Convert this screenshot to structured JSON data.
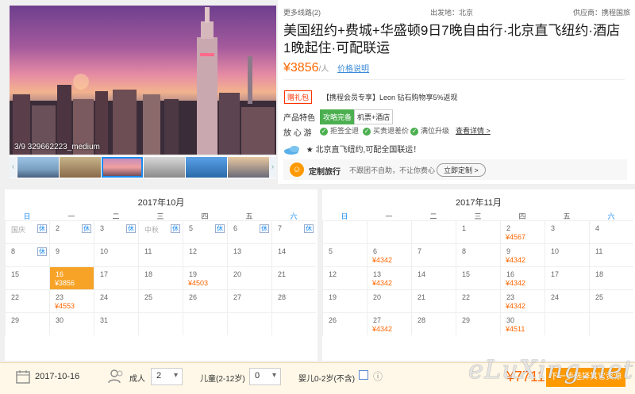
{
  "gallery": {
    "counter": "3/9 329662223_medium",
    "left_arrow": "‹",
    "right_arrow": "›"
  },
  "header": {
    "more_routes": "更多线路(2)",
    "departure": "出发地：北京",
    "supplier": "供应商：携程国旅"
  },
  "product": {
    "title": "美国纽约+费城+华盛顿9日7晚自由行·北京直飞纽约·酒店1晚起住·可配联运",
    "price": "¥3856",
    "price_unit": "/人",
    "price_link": "价格说明",
    "gift_badge": "赠礼包",
    "vip_text": "【携程会员专享】Leon 钻石购物享5%返现",
    "features_label": "产品特色",
    "tags": [
      "攻略完备",
      "机票+酒店"
    ],
    "assure_label": "放 心 游",
    "assurances": [
      "拒签全退",
      "买贵退差价",
      "满位升级"
    ],
    "assure_detail": "查看详情 >",
    "feature_note": "★ 北京直飞纽约,可配全国联运！",
    "custom_title": "定制旅行",
    "custom_desc": "不跟团不自助，不让你费心",
    "custom_button": "立即定制 >"
  },
  "calendar": {
    "weekdays": [
      "日",
      "一",
      "二",
      "三",
      "四",
      "五",
      "六"
    ],
    "months": [
      {
        "title": "2017年10月",
        "cells": [
          {
            "d": "国庆",
            "r": 0,
            "c": 0,
            "gray": true,
            "rest": "休"
          },
          {
            "d": "2",
            "r": 0,
            "c": 1,
            "rest": "休"
          },
          {
            "d": "3",
            "r": 0,
            "c": 2,
            "rest": "休"
          },
          {
            "d": "中秋",
            "r": 0,
            "c": 3,
            "gray": true,
            "rest": "休"
          },
          {
            "d": "5",
            "r": 0,
            "c": 4,
            "rest": "休"
          },
          {
            "d": "6",
            "r": 0,
            "c": 5,
            "rest": "休"
          },
          {
            "d": "7",
            "r": 0,
            "c": 6,
            "rest": "休"
          },
          {
            "d": "8",
            "r": 1,
            "c": 0,
            "rest": "休"
          },
          {
            "d": "9",
            "r": 1,
            "c": 1
          },
          {
            "d": "10",
            "r": 1,
            "c": 2
          },
          {
            "d": "11",
            "r": 1,
            "c": 3
          },
          {
            "d": "12",
            "r": 1,
            "c": 4
          },
          {
            "d": "13",
            "r": 1,
            "c": 5
          },
          {
            "d": "14",
            "r": 1,
            "c": 6
          },
          {
            "d": "15",
            "r": 2,
            "c": 0
          },
          {
            "d": "16",
            "r": 2,
            "c": 1,
            "p": "¥3856",
            "sel": true
          },
          {
            "d": "17",
            "r": 2,
            "c": 2
          },
          {
            "d": "18",
            "r": 2,
            "c": 3
          },
          {
            "d": "19",
            "r": 2,
            "c": 4,
            "p": "¥4503"
          },
          {
            "d": "20",
            "r": 2,
            "c": 5
          },
          {
            "d": "21",
            "r": 2,
            "c": 6
          },
          {
            "d": "22",
            "r": 3,
            "c": 0
          },
          {
            "d": "23",
            "r": 3,
            "c": 1,
            "p": "¥4553"
          },
          {
            "d": "24",
            "r": 3,
            "c": 2
          },
          {
            "d": "25",
            "r": 3,
            "c": 3
          },
          {
            "d": "26",
            "r": 3,
            "c": 4
          },
          {
            "d": "27",
            "r": 3,
            "c": 5
          },
          {
            "d": "28",
            "r": 3,
            "c": 6
          },
          {
            "d": "29",
            "r": 4,
            "c": 0
          },
          {
            "d": "30",
            "r": 4,
            "c": 1
          },
          {
            "d": "31",
            "r": 4,
            "c": 2
          }
        ]
      },
      {
        "title": "2017年11月",
        "cells": [
          {
            "d": "1",
            "r": 0,
            "c": 3
          },
          {
            "d": "2",
            "r": 0,
            "c": 4,
            "p": "¥4567"
          },
          {
            "d": "3",
            "r": 0,
            "c": 5
          },
          {
            "d": "4",
            "r": 0,
            "c": 6
          },
          {
            "d": "5",
            "r": 1,
            "c": 0
          },
          {
            "d": "6",
            "r": 1,
            "c": 1,
            "p": "¥4342"
          },
          {
            "d": "7",
            "r": 1,
            "c": 2
          },
          {
            "d": "8",
            "r": 1,
            "c": 3
          },
          {
            "d": "9",
            "r": 1,
            "c": 4,
            "p": "¥4342"
          },
          {
            "d": "10",
            "r": 1,
            "c": 5
          },
          {
            "d": "11",
            "r": 1,
            "c": 6
          },
          {
            "d": "12",
            "r": 2,
            "c": 0
          },
          {
            "d": "13",
            "r": 2,
            "c": 1,
            "p": "¥4342"
          },
          {
            "d": "14",
            "r": 2,
            "c": 2
          },
          {
            "d": "15",
            "r": 2,
            "c": 3
          },
          {
            "d": "16",
            "r": 2,
            "c": 4,
            "p": "¥4342"
          },
          {
            "d": "17",
            "r": 2,
            "c": 5
          },
          {
            "d": "18",
            "r": 2,
            "c": 6
          },
          {
            "d": "19",
            "r": 3,
            "c": 0
          },
          {
            "d": "20",
            "r": 3,
            "c": 1
          },
          {
            "d": "21",
            "r": 3,
            "c": 2
          },
          {
            "d": "22",
            "r": 3,
            "c": 3
          },
          {
            "d": "23",
            "r": 3,
            "c": 4,
            "p": "¥4342"
          },
          {
            "d": "24",
            "r": 3,
            "c": 5
          },
          {
            "d": "25",
            "r": 3,
            "c": 6
          },
          {
            "d": "26",
            "r": 4,
            "c": 0
          },
          {
            "d": "27",
            "r": 4,
            "c": 1,
            "p": "¥4342"
          },
          {
            "d": "28",
            "r": 4,
            "c": 2
          },
          {
            "d": "29",
            "r": 4,
            "c": 3
          },
          {
            "d": "30",
            "r": 4,
            "c": 4,
            "p": "¥4511"
          }
        ]
      }
    ]
  },
  "booking": {
    "date": "2017-10-16",
    "adult_label": "成人",
    "adult_value": "2",
    "child_label": "儿童(2-12岁)",
    "child_value": "0",
    "infant_label": "婴儿0-2岁(不含)",
    "info_icon": "ⓘ",
    "total": "¥7711",
    "next_button": "下一步选择其它资源"
  },
  "watermark": "eLuXing.net",
  "colors": {
    "accent": "#ff6600",
    "button": "#ff9900",
    "selected_date": "#f7a328",
    "link": "#1a8cf0",
    "green": "#4caf50"
  }
}
